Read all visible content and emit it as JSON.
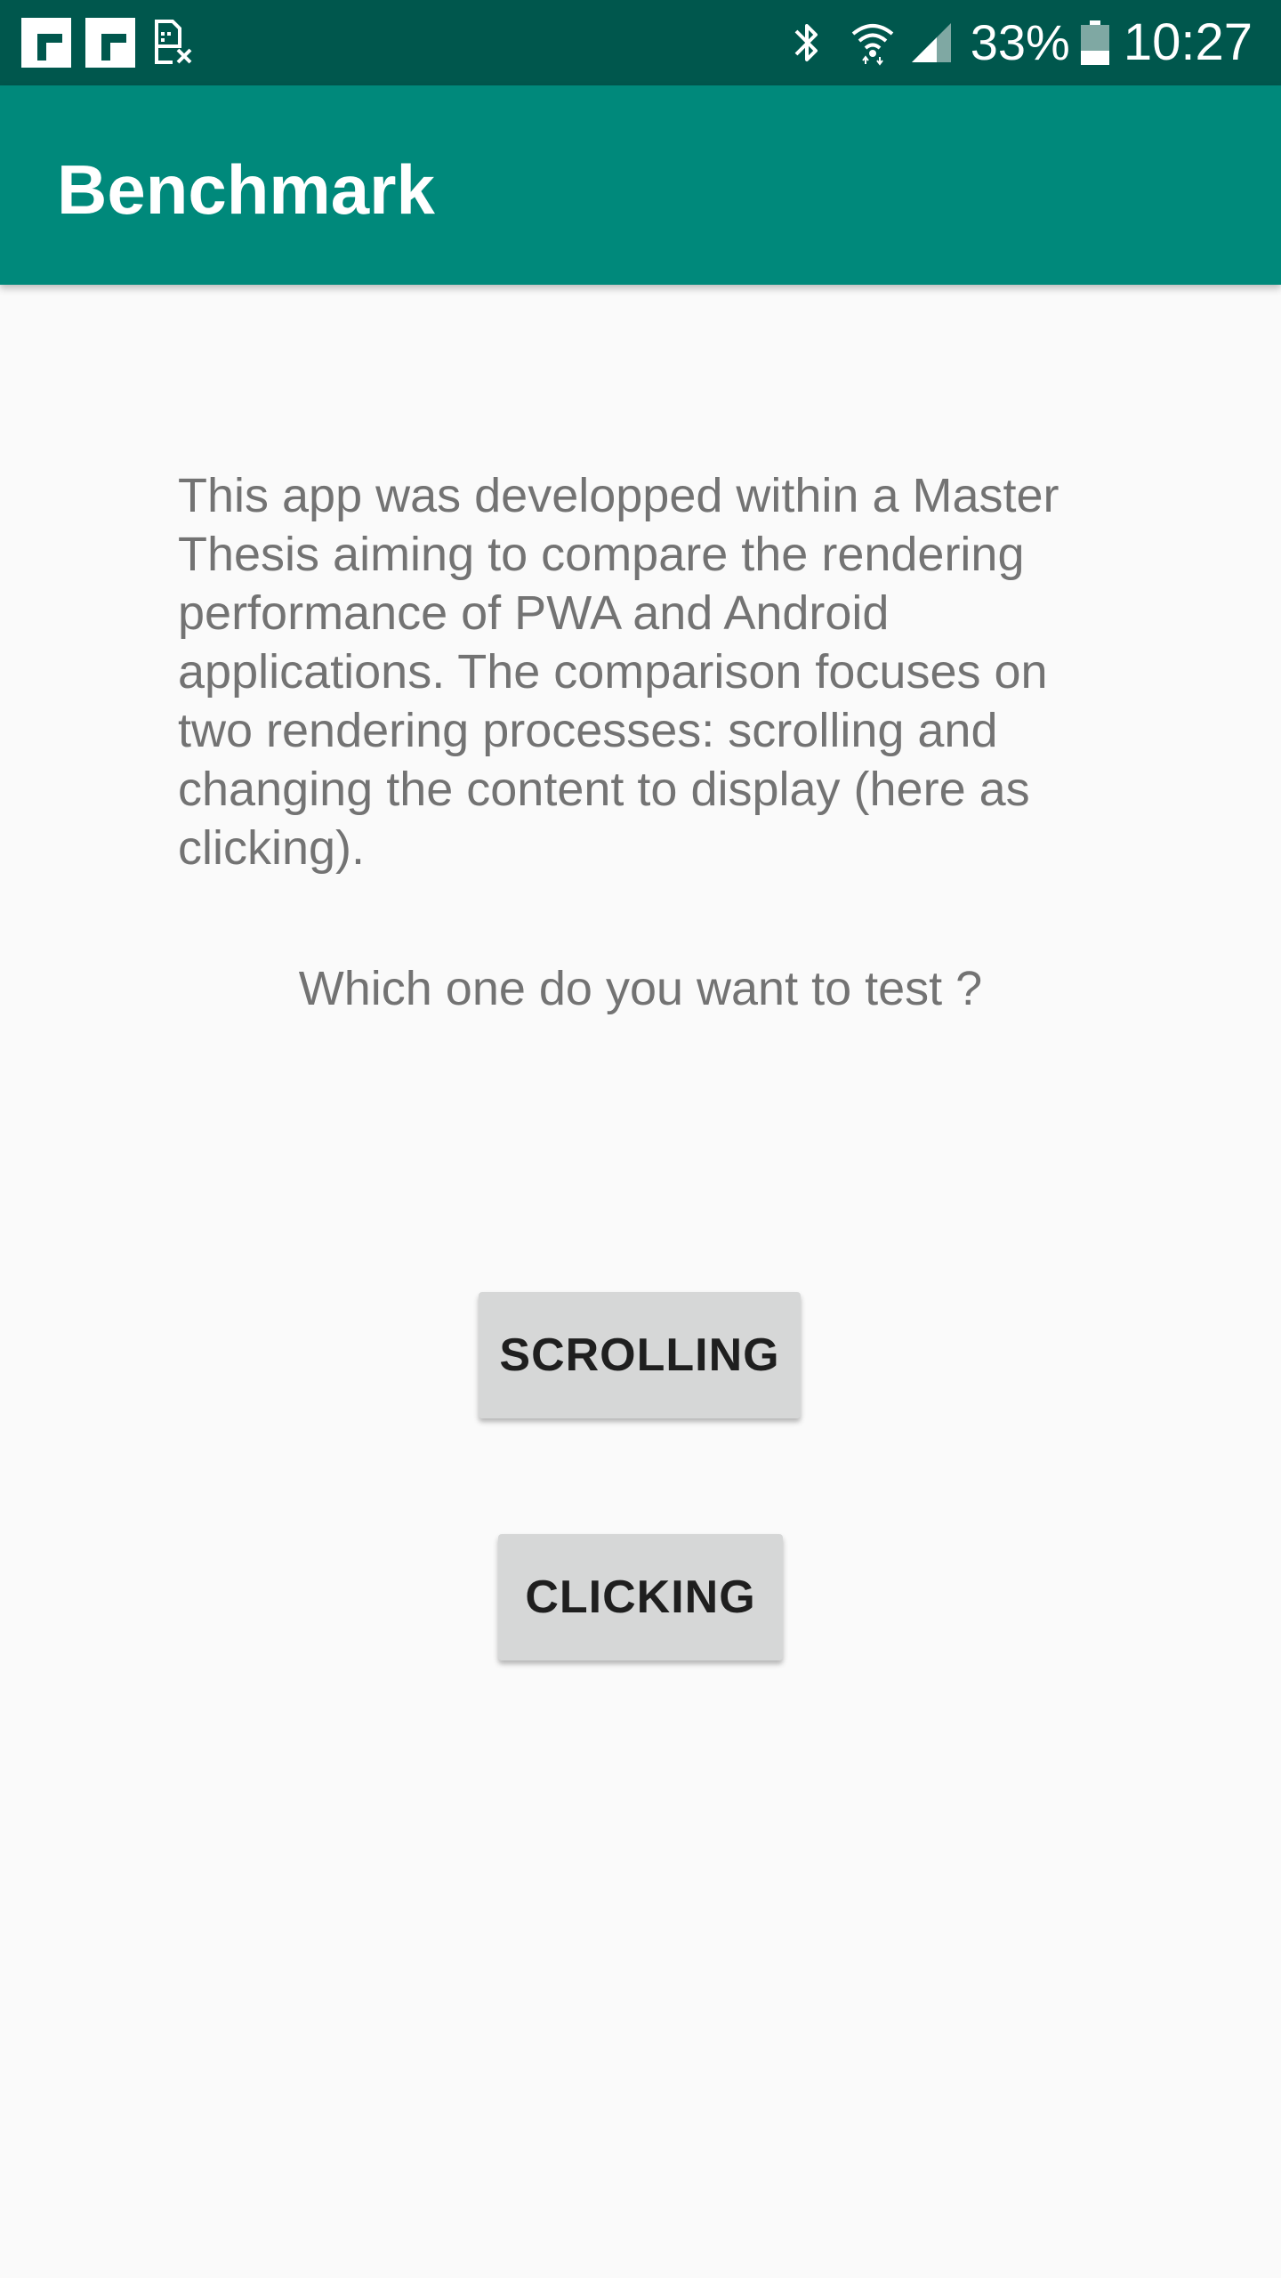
{
  "status_bar": {
    "battery_percent": "33%",
    "time": "10:27",
    "icons": [
      "flipboard-icon",
      "flipboard-icon",
      "no-sim-icon",
      "bluetooth-icon",
      "wifi-icon",
      "signal-icon",
      "battery-icon"
    ]
  },
  "app_bar": {
    "title": "Benchmark",
    "color": "#00897b",
    "status_color": "#00574d"
  },
  "main": {
    "description": "This app was developped within a Master Thesis aiming to compare the rendering performance of PWA and Android applications. The comparison focuses on two rendering processes: scrolling and changing the content to display (here as clicking).",
    "question": "Which one do you want to test ?",
    "buttons": {
      "scrolling_label": "SCROLLING",
      "clicking_label": "CLICKING"
    }
  }
}
